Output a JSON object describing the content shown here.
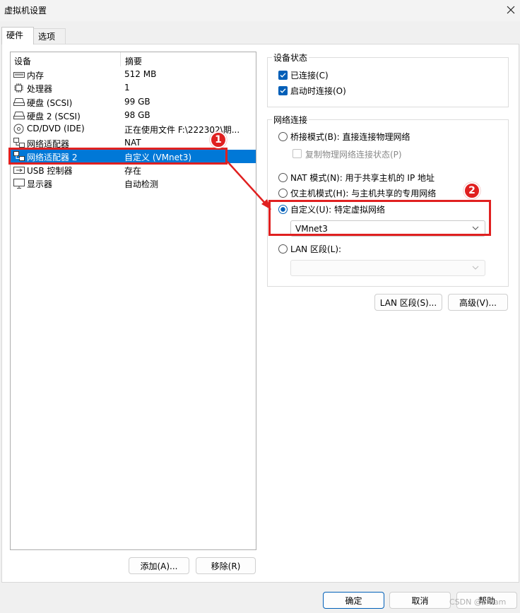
{
  "window": {
    "title": "虚拟机设置",
    "close_icon": "close-icon"
  },
  "tabs": [
    {
      "label": "硬件",
      "active": true
    },
    {
      "label": "选项",
      "active": false
    }
  ],
  "device_table": {
    "headers": [
      "设备",
      "摘要"
    ],
    "rows": [
      {
        "icon": "memory-icon",
        "name": "内存",
        "summary": "512 MB",
        "selected": false
      },
      {
        "icon": "cpu-icon",
        "name": "处理器",
        "summary": "1",
        "selected": false
      },
      {
        "icon": "disk-icon",
        "name": "硬盘 (SCSI)",
        "summary": "99 GB",
        "selected": false
      },
      {
        "icon": "disk-icon",
        "name": "硬盘 2 (SCSI)",
        "summary": "98 GB",
        "selected": false
      },
      {
        "icon": "cd-icon",
        "name": "CD/DVD (IDE)",
        "summary": "正在使用文件 F:\\222302\\期...",
        "selected": false
      },
      {
        "icon": "network-icon",
        "name": "网络适配器",
        "summary": "NAT",
        "selected": false
      },
      {
        "icon": "network-icon",
        "name": "网络适配器 2",
        "summary": "自定义 (VMnet3)",
        "selected": true
      },
      {
        "icon": "usb-icon",
        "name": "USB 控制器",
        "summary": "存在",
        "selected": false
      },
      {
        "icon": "monitor-icon",
        "name": "显示器",
        "summary": "自动检测",
        "selected": false
      }
    ],
    "add_button": "添加(A)...",
    "remove_button": "移除(R)"
  },
  "device_status": {
    "title": "设备状态",
    "connected": {
      "label": "已连接(C)",
      "checked": true
    },
    "connect_at_power_on": {
      "label": "启动时连接(O)",
      "checked": true
    }
  },
  "network_connection": {
    "title": "网络连接",
    "bridged": {
      "label": "桥接模式(B): 直接连接物理网络",
      "selected": false
    },
    "replicate": {
      "label": "复制物理网络连接状态(P)",
      "checked": false,
      "enabled": false
    },
    "nat": {
      "label": "NAT 模式(N): 用于共享主机的 IP 地址",
      "selected": false
    },
    "host_only": {
      "label": "仅主机模式(H): 与主机共享的专用网络",
      "selected": false
    },
    "custom": {
      "label": "自定义(U): 特定虚拟网络",
      "selected": true,
      "value": "VMnet3"
    },
    "lan_segment": {
      "label": "LAN 区段(L):",
      "selected": false,
      "value": ""
    }
  },
  "right_buttons": {
    "lan_segments": "LAN 区段(S)...",
    "advanced": "高级(V)..."
  },
  "footer": {
    "ok": "确定",
    "cancel": "取消",
    "help": "帮助"
  },
  "annotations": {
    "badge1": "1",
    "badge2": "2",
    "color": "#e02020"
  },
  "watermark": "CSDN @kfaam"
}
